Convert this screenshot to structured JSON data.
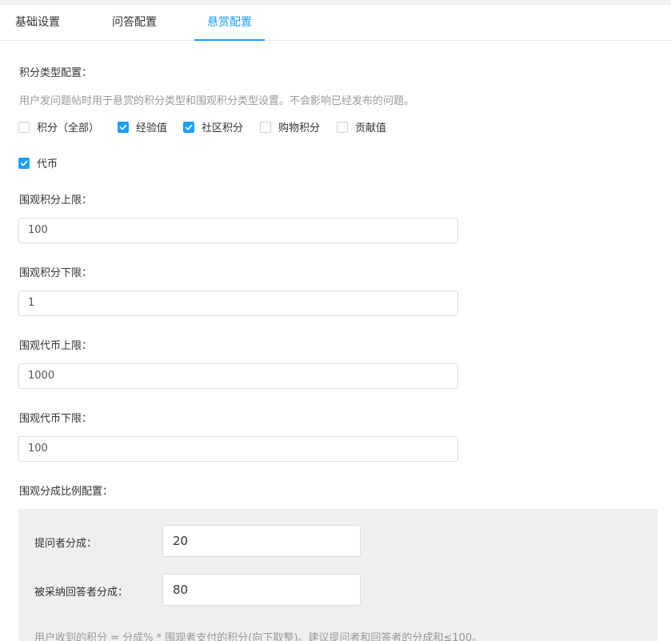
{
  "tabs": [
    {
      "label": "基础设置"
    },
    {
      "label": "问答配置"
    },
    {
      "label": "悬赏配置"
    }
  ],
  "active_tab": "悬赏配置",
  "accent_color": "#1e9fff",
  "points_type": {
    "title": "积分类型配置：",
    "description": "用户发问题帖时用于悬赏的积分类型和围观积分类型设置。不会影响已经发布的问题。",
    "options": [
      {
        "label": "积分（全部）",
        "checked": false
      },
      {
        "label": "经验值",
        "checked": true
      },
      {
        "label": "社区积分",
        "checked": true
      },
      {
        "label": "购物积分",
        "checked": false
      },
      {
        "label": "贡献值",
        "checked": false
      },
      {
        "label": "代币",
        "checked": true
      }
    ]
  },
  "fields": [
    {
      "label": "围观积分上限：",
      "value": "100"
    },
    {
      "label": "围观积分下限：",
      "value": "1"
    },
    {
      "label": "围观代币上限：",
      "value": "1000"
    },
    {
      "label": "围观代币下限：",
      "value": "100"
    }
  ],
  "ratio": {
    "title": "围观分成比例配置：",
    "asker_label": "提问者分成：",
    "asker_value": "20",
    "answerer_label": "被采纳回答者分成：",
    "answerer_value": "80",
    "note": "用户收到的积分 = 分成% * 围观者支付的积分(向下取整)。建议提问者和回答者的分成和≤100。"
  }
}
